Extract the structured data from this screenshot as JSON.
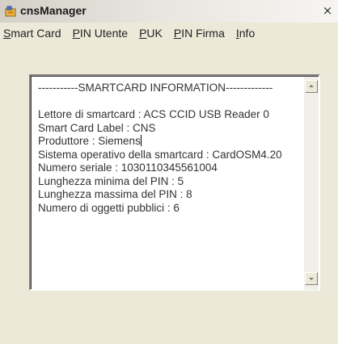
{
  "window": {
    "title": "cnsManager",
    "close_glyph": "×",
    "icon": "app-icon"
  },
  "menu": {
    "items": [
      {
        "accel": "S",
        "rest": "mart Card"
      },
      {
        "accel": "P",
        "rest": "IN Utente"
      },
      {
        "accel": "P",
        "rest": "UK"
      },
      {
        "accel": "P",
        "rest": "IN Firma"
      },
      {
        "accel": "I",
        "rest": "nfo"
      }
    ]
  },
  "info": {
    "header": "-----------SMARTCARD INFORMATION-------------",
    "lines": [
      "Lettore di smartcard : ACS CCID USB Reader 0",
      "Smart Card Label : CNS",
      "Produttore : Siemens",
      "Sistema operativo della smartcard : CardOSM4.20",
      "Numero seriale : 1030110345561004",
      "Lunghezza minima del PIN : 5",
      "Lunghezza massima del PIN : 8",
      "Numero di oggetti pubblici : 6"
    ]
  }
}
